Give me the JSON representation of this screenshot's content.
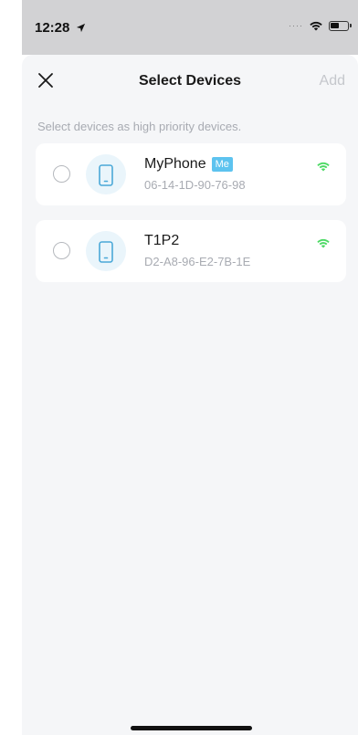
{
  "status_bar": {
    "time": "12:28",
    "location_icon": "location-arrow-icon",
    "signal_icon": "signal-dots-icon",
    "wifi_icon": "wifi-icon",
    "battery_icon": "battery-icon"
  },
  "nav": {
    "title": "Select Devices",
    "add_label": "Add",
    "close_icon": "close-icon"
  },
  "hint": "Select devices as high priority devices.",
  "devices": [
    {
      "name": "MyPhone",
      "badge": "Me",
      "mac": "06-14-1D-90-76-98",
      "icon": "phone-icon",
      "signal_icon": "wifi-signal-icon",
      "selected": false
    },
    {
      "name": "T1P2",
      "badge": "",
      "mac": "D2-A8-96-E2-7B-1E",
      "icon": "phone-icon",
      "signal_icon": "wifi-signal-icon",
      "selected": false
    }
  ],
  "colors": {
    "accent": "#5dc3ef",
    "wifi_green": "#4cd964",
    "sheet_bg": "#f5f6f8",
    "disabled_text": "#c5c7cc"
  }
}
